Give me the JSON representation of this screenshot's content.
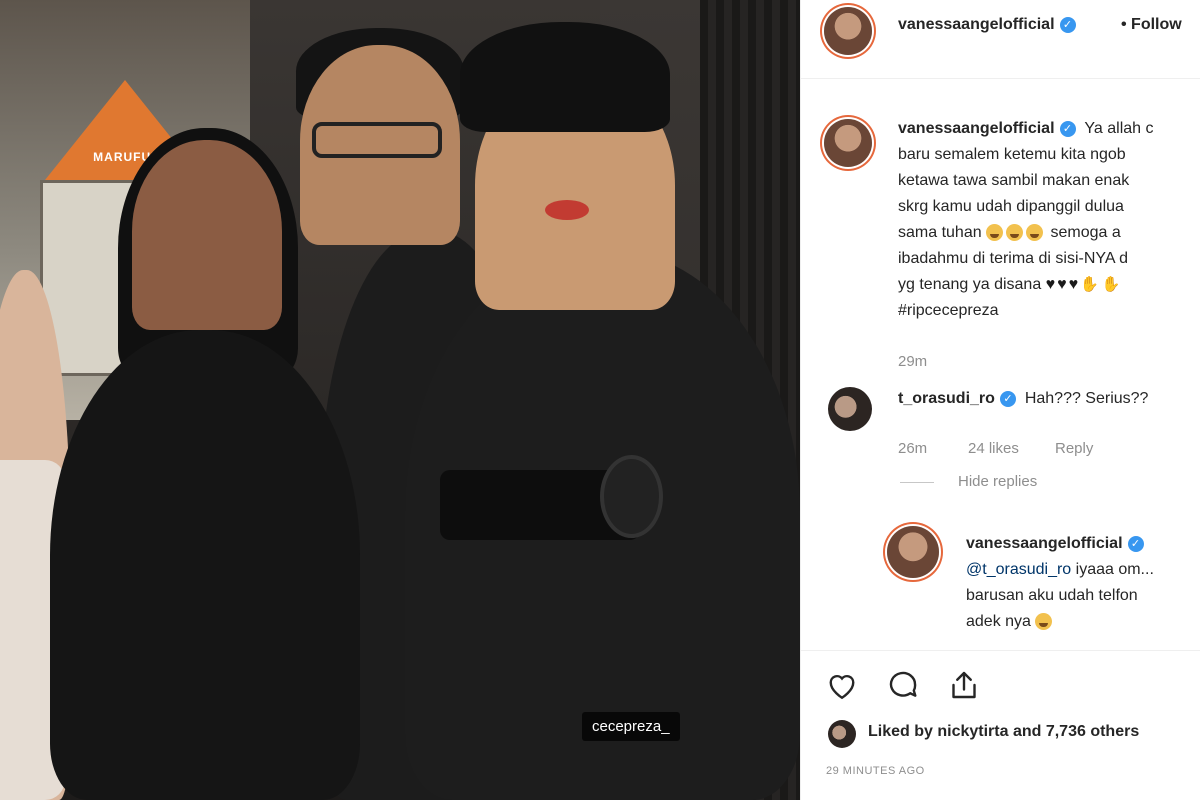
{
  "photo": {
    "sign_text": "MARUFUK",
    "tag": "cecepreza_"
  },
  "header": {
    "username": "vanessaangelofficial",
    "follow": "• Follow"
  },
  "caption": {
    "username": "vanessaangelofficial",
    "lines": [
      "Ya allah c",
      "baru semalem ketemu kita ngob",
      "ketawa tawa sambil makan enak",
      "skrg kamu udah dipanggil dulua",
      "sama tuhan",
      "semoga a",
      "ibadahmu di terima di sisi-NYA d",
      "yg tenang ya disana",
      "#ripcecepreza"
    ],
    "time": "29m"
  },
  "comment1": {
    "username": "t_orasudi_ro",
    "text": "Hah??? Serius??",
    "time": "26m",
    "likes": "24 likes",
    "reply": "Reply",
    "hide_replies": "Hide replies"
  },
  "reply1": {
    "username": "vanessaangelofficial",
    "mention": "@t_orasudi_ro",
    "text1": " iyaaa om...",
    "text2": "barusan aku udah telfon",
    "text3": "adek nya"
  },
  "likes": {
    "text": "Liked by nickytirta and 7,736 others"
  },
  "timestamp": "29 MINUTES AGO",
  "icons": {
    "like": "heart-outline-icon",
    "comment": "comment-bubble-icon",
    "share": "share-upload-icon",
    "verified": "verified-badge-icon"
  }
}
